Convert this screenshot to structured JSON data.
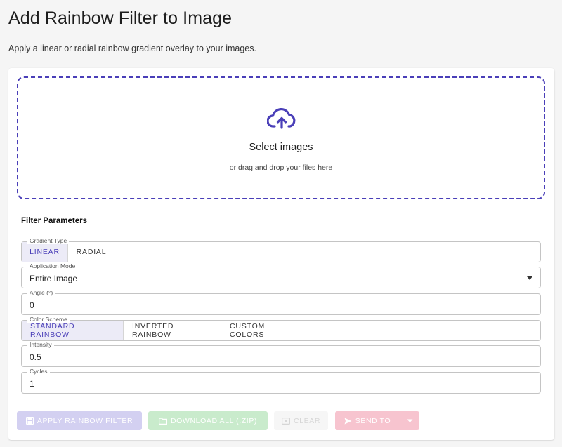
{
  "page": {
    "title": "Add Rainbow Filter to Image",
    "subtitle": "Apply a linear or radial rainbow gradient overlay to your images."
  },
  "dropzone": {
    "title": "Select images",
    "subtitle": "or drag and drop your files here",
    "icon": "cloud-upload-icon"
  },
  "filters": {
    "section_title": "Filter Parameters",
    "gradient_type": {
      "label": "Gradient Type",
      "options": [
        "LINEAR",
        "RADIAL"
      ],
      "selected": "LINEAR"
    },
    "application_mode": {
      "label": "Application Mode",
      "value": "Entire Image"
    },
    "angle": {
      "label": "Angle (°)",
      "value": "0"
    },
    "color_scheme": {
      "label": "Color Scheme",
      "options": [
        "STANDARD RAINBOW",
        "INVERTED RAINBOW",
        "CUSTOM COLORS"
      ],
      "selected": "STANDARD RAINBOW"
    },
    "intensity": {
      "label": "Intensity",
      "value": "0.5"
    },
    "cycles": {
      "label": "Cycles",
      "value": "1"
    }
  },
  "actions": {
    "apply": "APPLY RAINBOW FILTER",
    "download": "DOWNLOAD ALL (.ZIP)",
    "clear": "CLEAR",
    "send": "SEND TO"
  },
  "colors": {
    "accent": "#4a3fb8",
    "apply_disabled": "#d3d0f1",
    "download_disabled": "#c9ebcc",
    "send_disabled": "#f7c4cf"
  }
}
